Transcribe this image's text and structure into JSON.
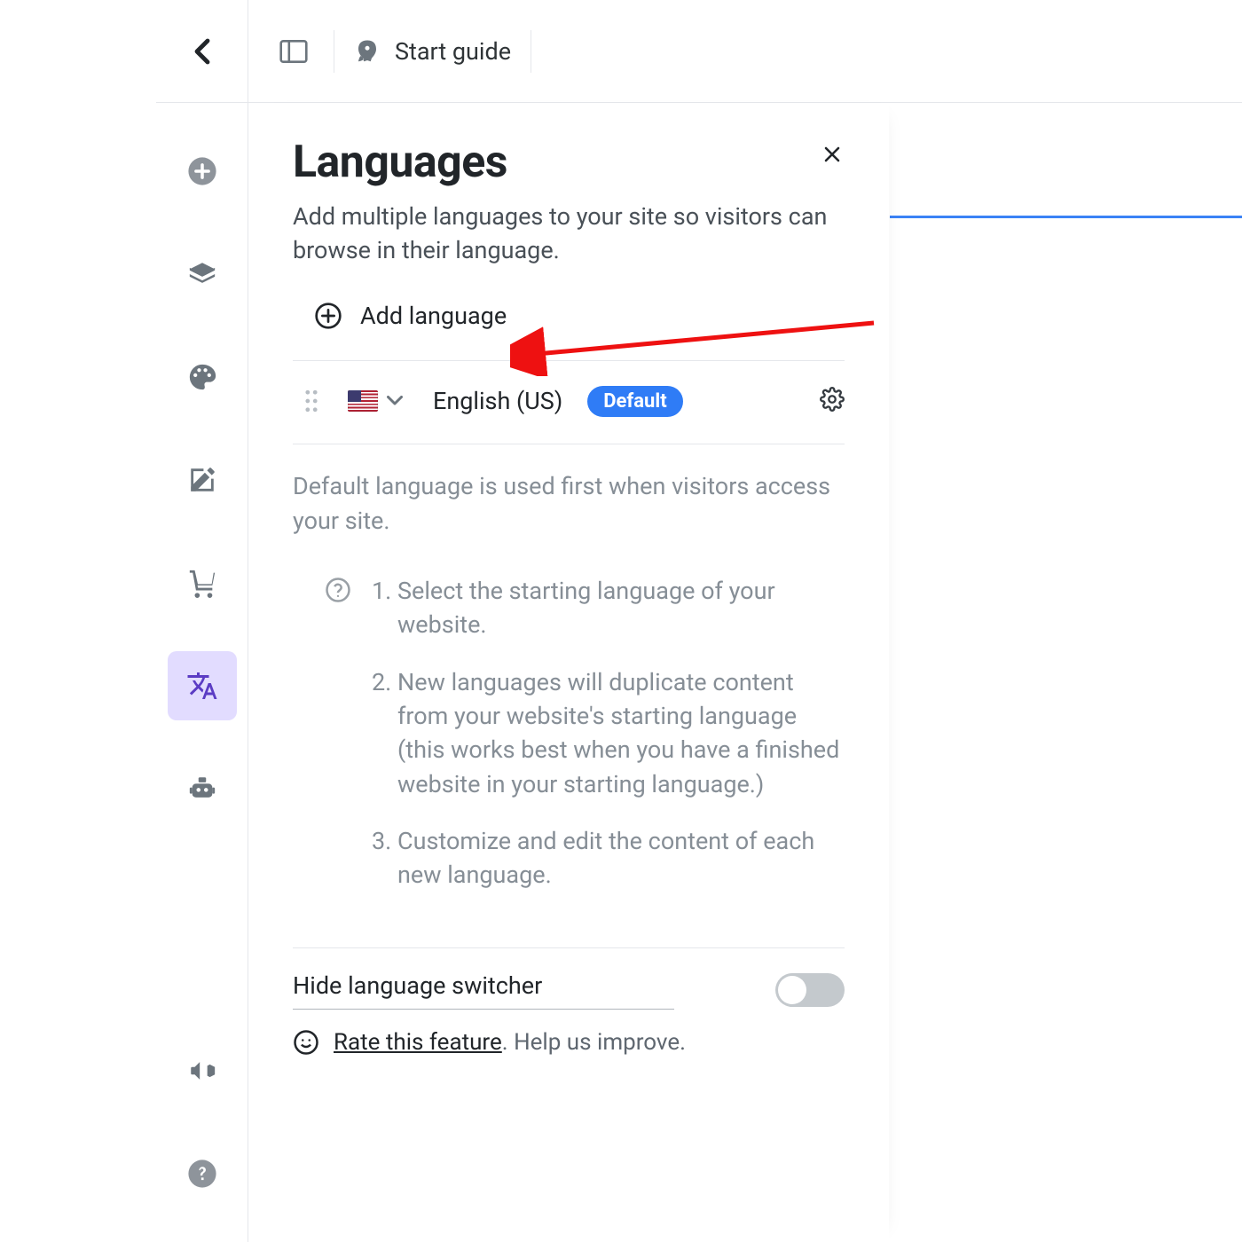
{
  "topbar": {
    "start_guide": "Start guide"
  },
  "panel": {
    "title": "Languages",
    "subtitle": "Add multiple languages to your site so visitors can browse in their language.",
    "add_language": "Add language",
    "lang0": {
      "name": "English (US)",
      "badge": "Default"
    },
    "default_hint": "Default language is used first when visitors access your site.",
    "steps": {
      "s1": "Select the starting language of your website.",
      "s2": "New languages will duplicate content from your website's starting language (this works best when you have a finished website in your starting language.)",
      "s3": "Customize and edit the content of each new language."
    },
    "hide_switcher": "Hide language switcher",
    "rate_link": "Rate this feature",
    "rate_tail": ". Help us improve."
  }
}
